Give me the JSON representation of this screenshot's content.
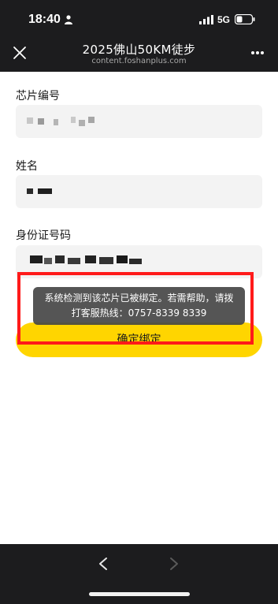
{
  "status_bar": {
    "time": "18:40",
    "network": "5G"
  },
  "header": {
    "title": "2025佛山50KM徒步",
    "subtitle": "content.foshanplus.com"
  },
  "form": {
    "chip_label": "芯片编号",
    "name_label": "姓名",
    "id_label": "身份证号码",
    "submit_label": "确定绑定"
  },
  "toast": {
    "line1": "系统检测到该芯片已被绑定。若需帮助，请拨",
    "line2": "打客服热线：0757-8339 8339"
  },
  "colors": {
    "accent": "#ffd500",
    "highlight": "#ff1a1a",
    "bar": "#1c1c1e"
  },
  "icons": [
    "person-icon",
    "signal-icon",
    "battery-icon",
    "close-icon",
    "more-icon",
    "back-icon",
    "forward-icon"
  ]
}
